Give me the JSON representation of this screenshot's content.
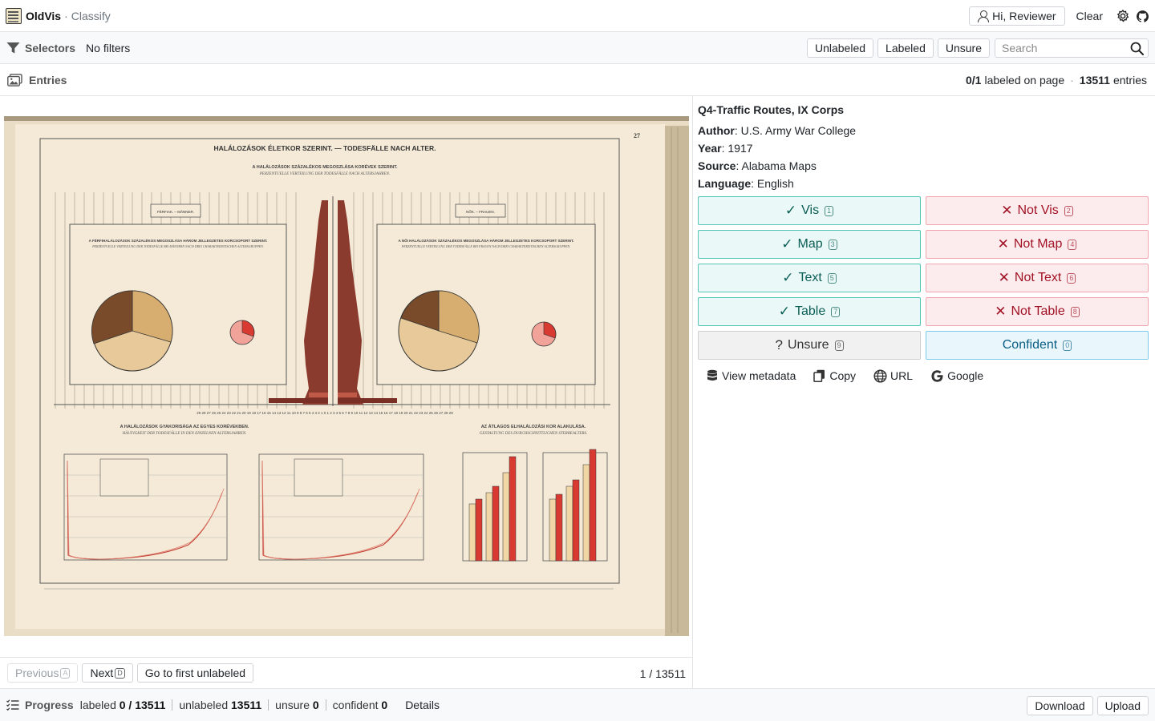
{
  "header": {
    "app_name": "OldVis",
    "separator": "·",
    "page_name": "Classify",
    "user_label": "Hi, Reviewer",
    "clear_label": "Clear",
    "icons": [
      "logo-icon",
      "user-icon",
      "gear-icon",
      "github-icon"
    ]
  },
  "selectors": {
    "title": "Selectors",
    "filter_status": "No filters",
    "buttons": [
      "Unlabeled",
      "Labeled",
      "Unsure"
    ],
    "search_placeholder": "Search"
  },
  "entries": {
    "title": "Entries",
    "labeled_on_page": "0/1",
    "labeled_on_page_suffix": "labeled on page",
    "separator": "·",
    "total": "13511",
    "total_suffix": "entries"
  },
  "item": {
    "title": "Q4-Traffic Routes, IX Corps",
    "meta": [
      {
        "key": "Author",
        "value": "U.S. Army War College"
      },
      {
        "key": "Year",
        "value": "1917"
      },
      {
        "key": "Source",
        "value": "Alabama Maps"
      },
      {
        "key": "Language",
        "value": "English"
      }
    ],
    "scan_text": {
      "page_number": "27",
      "main_title": "HALÁLOZÁSOK ÉLETKOR SZERINT. — TODESFÄLLE NACH ALTER.",
      "sub_title_1": "A HALÁLOZÁSOK SZÁZALÉKOS MEGOSZLÁSA KORÉVEK SZERINT.",
      "sub_title_2": "PERZENTUELLE VERTEILUNG DER TODESFÄLLE NACH ALTERSJAHREN.",
      "male_label": "FÉRFIAK. – MÄNNER.",
      "female_label": "NŐK. – FRAUEN.",
      "lower_title_1": "A HALÁLOZÁSOK GYAKORISÁGA AZ EGYES KORÉVEKBEN.",
      "lower_title_2": "HÄUFIGKEIT DER TODESFÄLLE IN DEN EINZELNEN ALTERSJAHREN.",
      "right_title_1": "AZ ÁTLAGOS ELHALÁLOZÁSI KOR ALAKULÁSA.",
      "right_title_2": "GESTALTUNG DES DURCHSCHNITTLICHEN STERBEALTERS."
    }
  },
  "labels": [
    {
      "text": "Vis",
      "key": "1",
      "kind": "pos"
    },
    {
      "text": "Not Vis",
      "key": "2",
      "kind": "neg"
    },
    {
      "text": "Map",
      "key": "3",
      "kind": "pos"
    },
    {
      "text": "Not Map",
      "key": "4",
      "kind": "neg"
    },
    {
      "text": "Text",
      "key": "5",
      "kind": "pos"
    },
    {
      "text": "Not Text",
      "key": "6",
      "kind": "neg"
    },
    {
      "text": "Table",
      "key": "7",
      "kind": "pos"
    },
    {
      "text": "Not Table",
      "key": "8",
      "kind": "neg"
    },
    {
      "text": "Unsure",
      "key": "9",
      "kind": "uns"
    },
    {
      "text": "Confident",
      "key": "0",
      "kind": "conf"
    }
  ],
  "tools": [
    {
      "text": "View metadata",
      "icon": "database-icon"
    },
    {
      "text": "Copy",
      "icon": "copy-icon"
    },
    {
      "text": "URL",
      "icon": "globe-icon"
    },
    {
      "text": "Google",
      "icon": "google-icon"
    }
  ],
  "pager": {
    "previous_label": "Previous",
    "previous_key": "A",
    "next_label": "Next",
    "next_key": "D",
    "first_unlabeled_label": "Go to first unlabeled",
    "position": "1 / 13511"
  },
  "progress": {
    "title": "Progress",
    "labeled_label": "labeled",
    "labeled_value": "0 / 13511",
    "unlabeled_label": "unlabeled",
    "unlabeled_value": "13511",
    "unsure_label": "unsure",
    "unsure_value": "0",
    "confident_label": "confident",
    "confident_value": "0",
    "details_label": "Details",
    "download_label": "Download",
    "upload_label": "Upload"
  },
  "colors": {
    "positive_bg": "#eaf9f7",
    "positive_border": "#55c5b8",
    "positive_text": "#0b5e55",
    "negative_bg": "#fdecee",
    "negative_border": "#f0a4ad",
    "negative_text": "#a11225",
    "confident_bg": "#e9f6fc",
    "confident_text": "#0a5f86"
  }
}
